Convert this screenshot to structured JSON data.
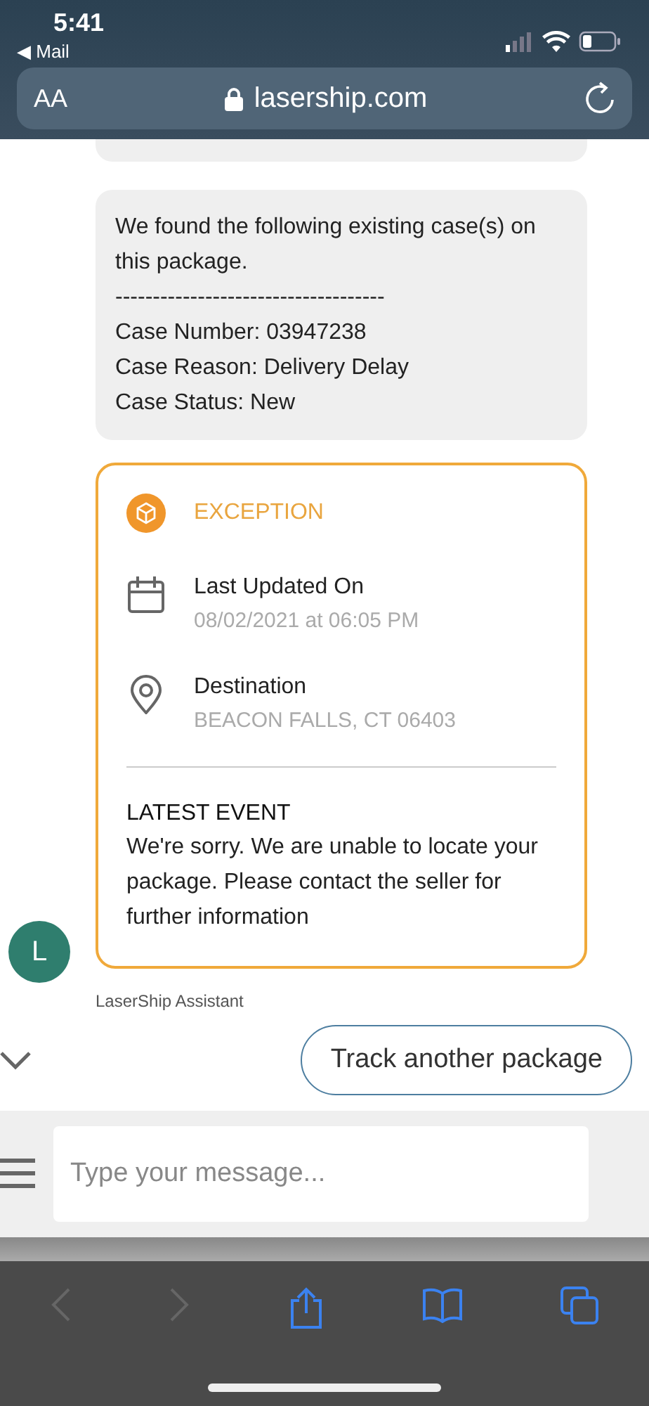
{
  "status_bar": {
    "time": "5:41",
    "back_app": "◀ Mail"
  },
  "url_bar": {
    "text_size": "AA",
    "url": "lasership.com"
  },
  "chat": {
    "case_message": {
      "lines": [
        "We found the following existing case(s) on this package.",
        "------------------------------------",
        "Case Number: 03947238",
        "Case Reason: Delivery Delay",
        "Case Status: New"
      ]
    },
    "tracking_card": {
      "status": "EXCEPTION",
      "details": [
        {
          "kind": "calendar",
          "label": "Last Updated On",
          "value": "08/02/2021 at 06:05 PM"
        },
        {
          "kind": "pin",
          "label": "Destination",
          "value": "BEACON FALLS, CT 06403"
        }
      ],
      "event_title": "LATEST EVENT",
      "event_text": "We're sorry. We are unable to locate your package. Please contact the seller for further information"
    },
    "avatar": "L",
    "sender": "LaserShip Assistant",
    "quick_reply": "Track another package"
  },
  "composer": {
    "placeholder": "Type your message..."
  },
  "toolbar": [
    {
      "kind": "back",
      "disabled": true
    },
    {
      "kind": "forward",
      "disabled": true
    },
    {
      "kind": "share",
      "disabled": false
    },
    {
      "kind": "bookmarks",
      "disabled": false
    },
    {
      "kind": "tabs",
      "disabled": false
    }
  ]
}
